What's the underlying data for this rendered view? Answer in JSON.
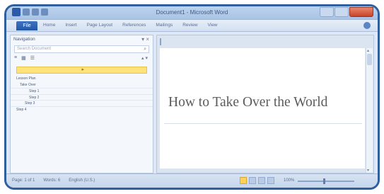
{
  "window": {
    "title": "Document1 - Microsoft Word"
  },
  "ribbon": {
    "file_tab": "File",
    "tabs": [
      "Home",
      "Insert",
      "Page Layout",
      "References",
      "Mailings",
      "Review",
      "View"
    ]
  },
  "navigation": {
    "header": "Navigation",
    "search_placeholder": "Search Document",
    "outline": [
      "Lesson Plan",
      "Take Over",
      "Step 1",
      "Step 2",
      "Step 3",
      "Step 4"
    ]
  },
  "document": {
    "title": "How to Take Over the World"
  },
  "status": {
    "page": "Page: 1 of 1",
    "words": "Words: 6",
    "language": "English (U.S.)",
    "zoom": "100%"
  },
  "colors": {
    "frame_border": "#2f5f9c",
    "file_tab": "#2456a6",
    "nav_highlight": "#ffe27a",
    "close_button": "#c8442a"
  }
}
